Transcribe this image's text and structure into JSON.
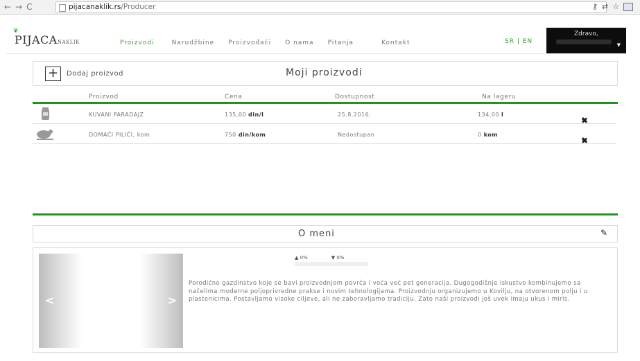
{
  "browser": {
    "url_host": "pijacanaklik.rs",
    "url_path": "/Producer"
  },
  "navbar": {
    "logo_main": "PIJACA",
    "logo_sub": "NAKLIK",
    "menu": [
      "Proizvodi",
      "Narudžbine",
      "Proizvođači",
      "O nama",
      "Pitanja",
      "Kontakt"
    ],
    "lang": "SR | EN",
    "greeting": "Zdravo,"
  },
  "products_panel": {
    "add_label": "Dodaj proizvod",
    "title": "Moji proizvodi",
    "columns": [
      "Proizvod",
      "Cena",
      "Dostupnost",
      "Na lageru"
    ],
    "rows": [
      {
        "name": "KUVANI PARADAJZ",
        "price": "135,00",
        "price_unit": "din/l",
        "availability": "25.8.2016.",
        "stock": "134,00",
        "stock_unit": "l"
      },
      {
        "name": "DOMAĆI PILIĆI, kom",
        "price": "750",
        "price_unit": "din/kom",
        "availability": "Nedostupan",
        "stock": "0",
        "stock_unit": "kom"
      }
    ]
  },
  "about": {
    "title": "O meni",
    "likes": "0%",
    "dislikes": "0%",
    "text": "Porodično gazdinstvo koje se bavi proizvodnjom povrća i voća već pet generacija. Dugogodišnje iskustvo kombinujemo sa načelima moderne poljoprivredne prakse i novim tehnologijama. Proizvodnju organizujemo u Kovilju, na otvorenom polju i u plastenicima. Postavljamo visoke ciljeve, ali ne zaboravljamo tradiciju. Zato naši proizvodi još uvek imaju ukus i miris."
  }
}
